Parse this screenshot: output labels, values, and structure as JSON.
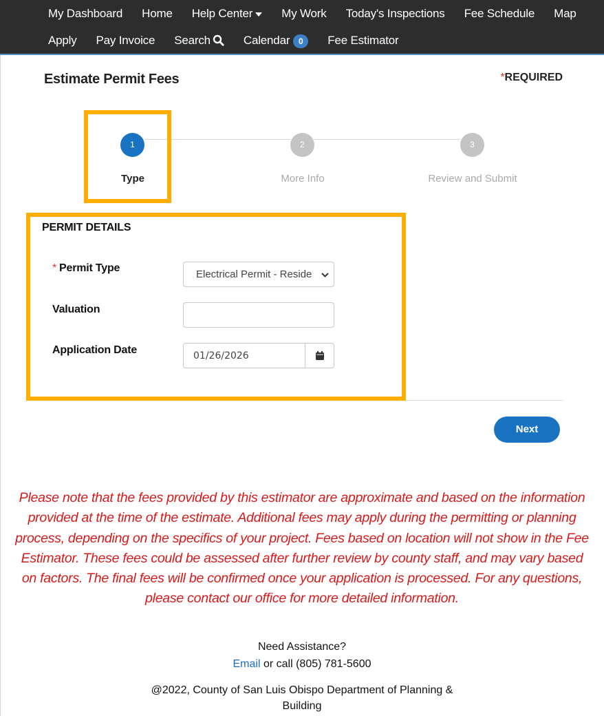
{
  "nav": {
    "row1": [
      {
        "label": "My Dashboard"
      },
      {
        "label": "Home"
      },
      {
        "label": "Help Center"
      },
      {
        "label": "My Work"
      },
      {
        "label": "Today's Inspections"
      },
      {
        "label": "Fee Schedule"
      },
      {
        "label": "Map"
      }
    ],
    "row2": [
      {
        "label": "Apply"
      },
      {
        "label": "Pay Invoice"
      },
      {
        "label": "Search"
      },
      {
        "label": "Calendar",
        "badge": "0"
      },
      {
        "label": "Fee Estimator"
      }
    ]
  },
  "page": {
    "title": "Estimate Permit Fees",
    "required_star": "*",
    "required_label": "REQUIRED"
  },
  "stepper": {
    "steps": [
      {
        "number": "1",
        "label": "Type",
        "active": true
      },
      {
        "number": "2",
        "label": "More Info",
        "active": false
      },
      {
        "number": "3",
        "label": "Review and Submit",
        "active": false
      }
    ]
  },
  "form": {
    "section_title": "PERMIT DETAILS",
    "permit_type": {
      "required_star": "*",
      "label": "Permit Type",
      "value": "Electrical Permit - Residential"
    },
    "valuation": {
      "label": "Valuation",
      "value": ""
    },
    "application_date": {
      "label": "Application Date",
      "value": "01/26/2026"
    }
  },
  "actions": {
    "next_label": "Next"
  },
  "disclaimer": {
    "lines": [
      "Please note that the fees provided by this estimator are approximate and based on the information",
      "provided at the time of the estimate. Additional fees may apply during the permitting or planning",
      "process, depending on the specifics of your project. Fees based on location will not show in the Fee",
      "Estimator. These fees could be assessed after further review by county staff, and may vary based",
      "on factors. The final fees will be confirmed once your application is processed. For any questions,",
      "please contact our office for more detailed information."
    ]
  },
  "footer": {
    "assistance": "Need Assistance?",
    "email_link": "Email",
    "call_text": " or call (805) 781-5600",
    "copyright_line1": "@2022, County of San Luis Obispo Department of Planning &",
    "copyright_line2": "Building"
  },
  "colors": {
    "nav_bg": "#2d2d2d",
    "accent": "#1a73c2",
    "highlight": "#ffae00",
    "disclaimer": "#d51b1b",
    "required_star": "#d9342b"
  },
  "icons": {
    "help_center": "caret-down-icon",
    "search": "search-icon",
    "permit_type": "chevron-down-icon",
    "application_date": "calendar-icon"
  }
}
